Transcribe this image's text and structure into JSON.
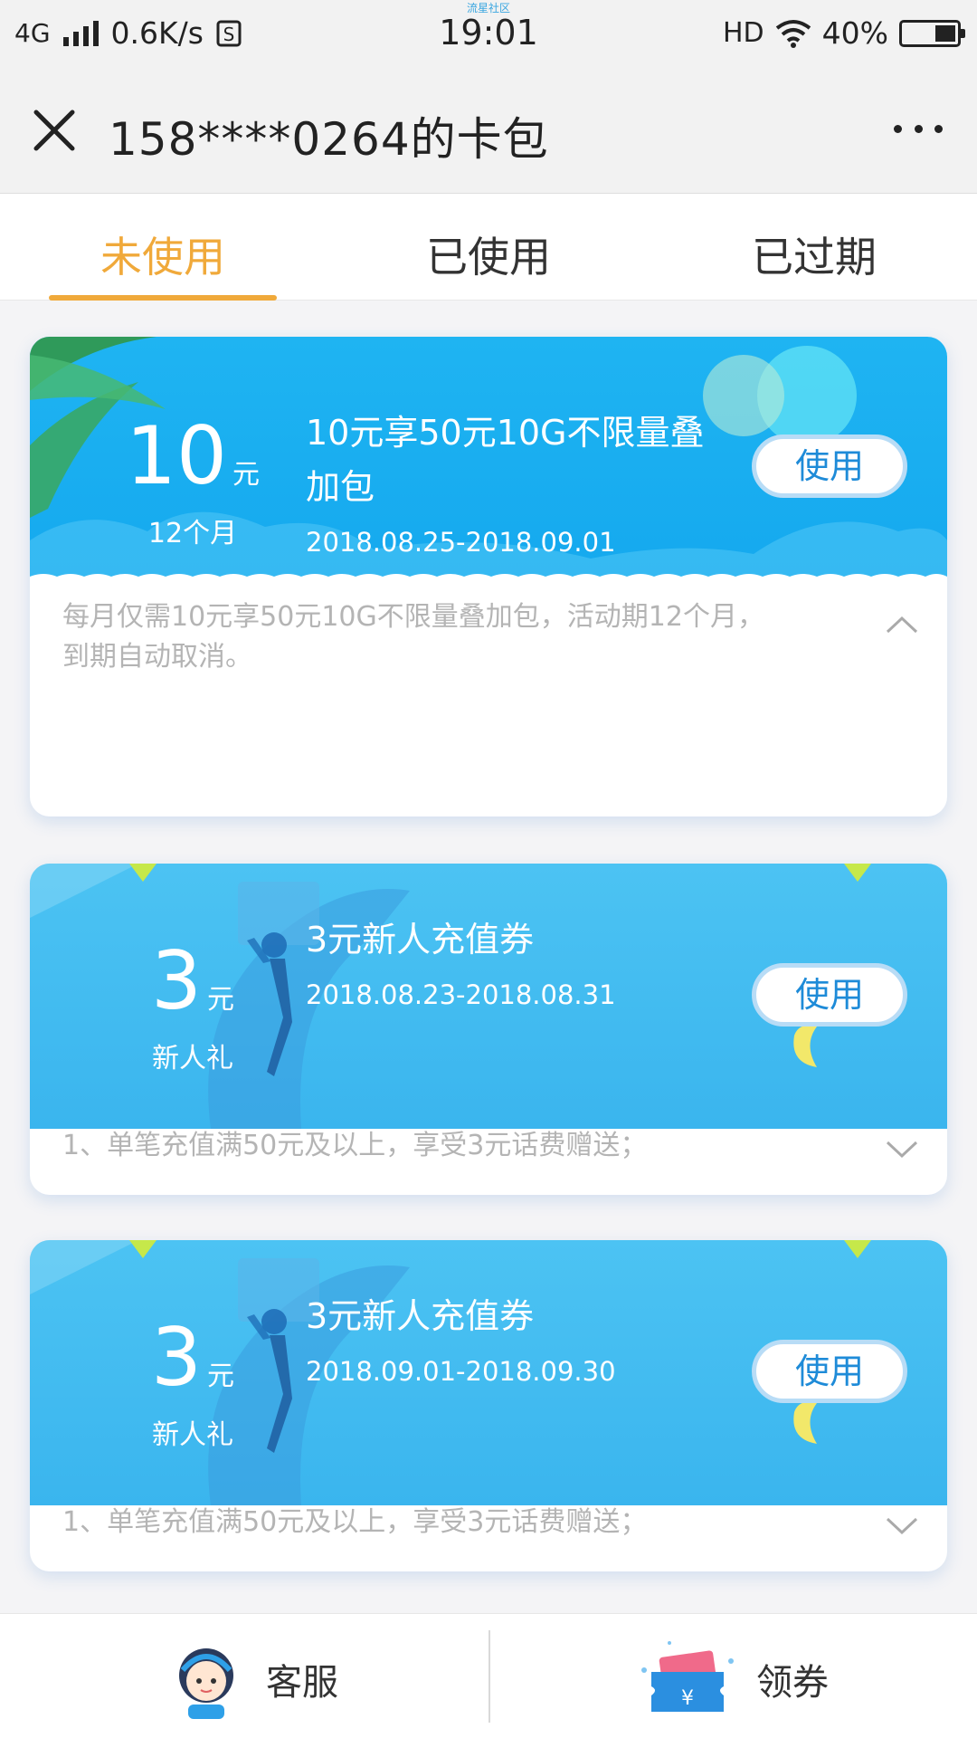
{
  "status_bar": {
    "network": "4G",
    "speed": "0.6K/s",
    "carrier_label": "流星社区",
    "time": "19:01",
    "hd": "HD",
    "battery": "40%"
  },
  "title_bar": {
    "title": "158****0264的卡包"
  },
  "tabs": [
    {
      "label": "未使用",
      "active": true
    },
    {
      "label": "已使用",
      "active": false
    },
    {
      "label": "已过期",
      "active": false
    }
  ],
  "coupons": [
    {
      "amount": "10",
      "unit": "元",
      "sub": "12个月",
      "name": "10元享50元10G不限量叠加包",
      "date": "2018.08.25-2018.09.01",
      "button": "使用",
      "description": "每月仅需10元享50元10G不限量叠加包，活动期12个月，到期自动取消。",
      "expanded": true
    },
    {
      "amount": "3",
      "unit": "元",
      "sub": "新人礼",
      "name": "3元新人充值券",
      "date": "2018.08.23-2018.08.31",
      "button": "使用",
      "description": "1、单笔充值满50元及以上，享受3元话费赠送；",
      "expanded": false
    },
    {
      "amount": "3",
      "unit": "元",
      "sub": "新人礼",
      "name": "3元新人充值券",
      "date": "2018.09.01-2018.09.30",
      "button": "使用",
      "description": "1、单笔充值满50元及以上，享受3元话费赠送；",
      "expanded": false
    }
  ],
  "bottom_bar": {
    "service_label": "客服",
    "coupon_label": "领券"
  },
  "colors": {
    "accent": "#f0a93a",
    "banner_blue": "#1fb4f2",
    "button_text": "#1e8bd8"
  }
}
